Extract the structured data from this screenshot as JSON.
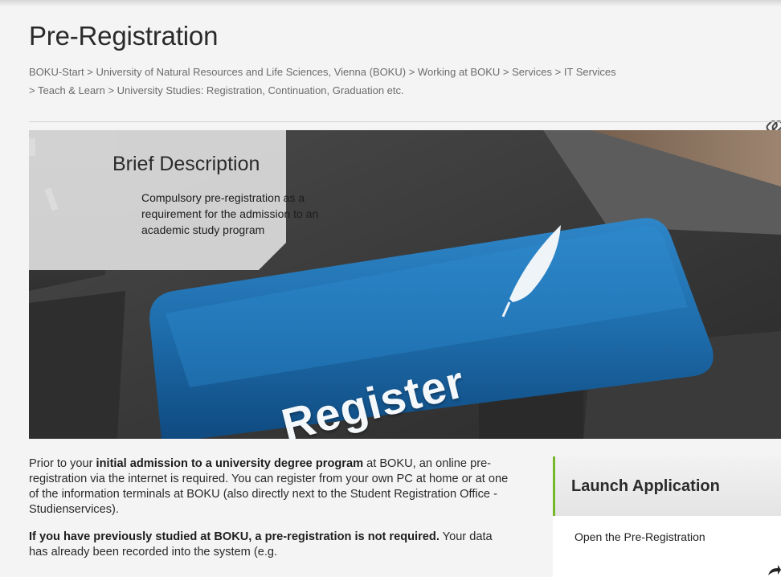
{
  "page": {
    "title": "Pre-Registration",
    "breadcrumb": [
      "BOKU-Start",
      "University of Natural Resources and Life Sciences, Vienna (BOKU)",
      "Working at BOKU",
      "Services",
      "IT Services",
      "Teach & Learn",
      "University Studies: Registration, Continuation, Graduation etc."
    ],
    "breadcrumb_separator": ">",
    "link_icon": "link-icon"
  },
  "hero": {
    "keyboard_key_label": "Register",
    "key_icon": "feather-icon",
    "key_color": "#1f6fad",
    "brief": {
      "title": "Brief Description",
      "text": "Compulsory pre-registration as a requirement for the admission to an academic study program"
    }
  },
  "content": {
    "p1_pre": "Prior to your ",
    "p1_bold": "initial admission to a university degree program",
    "p1_post": " at BOKU, an online pre-registration via the internet is required. You can register from your own PC at home or at one of the information terminals at BOKU (also directly next to the Student Registration Office - Studienservices).",
    "p2_bold": "If you have previously studied at BOKU, a pre-registration is not required.",
    "p2_post": " Your data has already been recorded into the system (e.g."
  },
  "sidebar": {
    "launch_title": "Launch Application",
    "launch_link": "Open the Pre-Registration",
    "accent_color": "#76b82a",
    "corner_icon": "arrow-icon"
  }
}
